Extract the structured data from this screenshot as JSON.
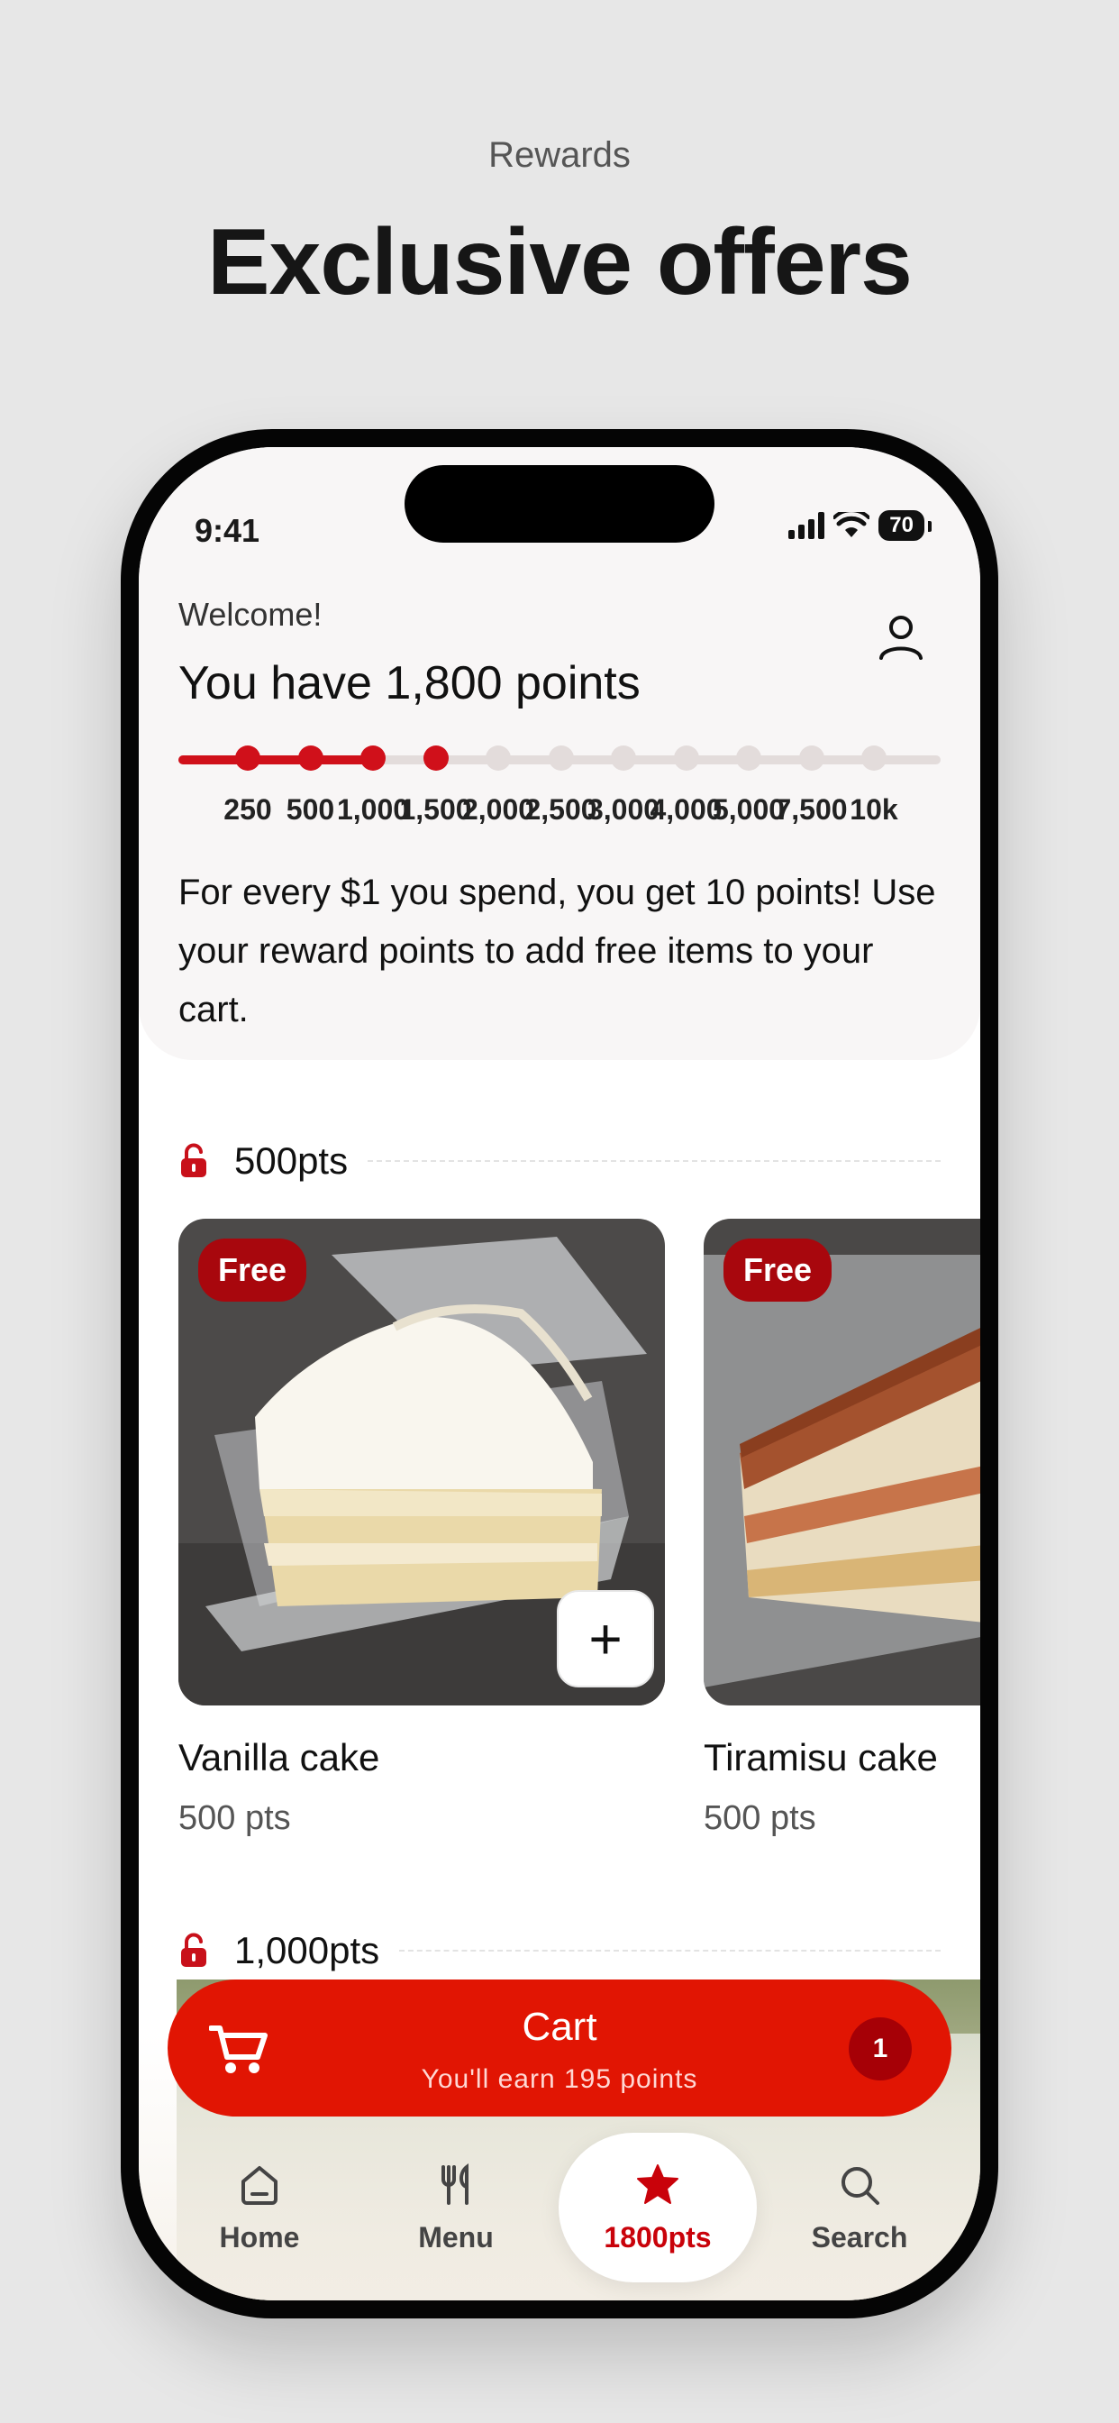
{
  "promo": {
    "eyebrow": "Rewards",
    "title": "Exclusive offers"
  },
  "status_bar": {
    "time": "9:41",
    "battery": "70"
  },
  "header": {
    "welcome": "Welcome!",
    "points_title": "You have 1,800 points",
    "profile_icon": "user-icon"
  },
  "progress": {
    "current_points": 1800,
    "tiers": [
      "250",
      "500",
      "1,000",
      "1,500",
      "2,000",
      "2,500",
      "3,000",
      "4,000",
      "5,000",
      "7,500",
      "10k"
    ],
    "reached_tiers": 4,
    "accent": "#d0101a",
    "track": "#e3dcdb"
  },
  "info": {
    "text": "For every $1 you spend, you get 10 points! Use your reward points to add free items to your cart."
  },
  "sections": [
    {
      "label": "500pts",
      "icon": "unlock-icon",
      "items": [
        {
          "badge": "Free",
          "name": "Vanilla cake",
          "pts": "500 pts",
          "add_icon": "plus-icon"
        },
        {
          "badge": "Free",
          "name": "Tiramisu cake",
          "pts": "500 pts"
        }
      ]
    },
    {
      "label": "1,000pts",
      "icon": "unlock-icon"
    }
  ],
  "cart": {
    "title": "Cart",
    "subtitle": "You'll earn 195 points",
    "count": "1",
    "icon": "cart-icon",
    "color": "#e11503"
  },
  "tabbar": {
    "tabs": [
      {
        "label": "Home",
        "icon": "home-icon"
      },
      {
        "label": "Menu",
        "icon": "utensils-icon"
      },
      {
        "label": "1800pts",
        "icon": "star-icon",
        "active": true
      },
      {
        "label": "Search",
        "icon": "search-icon"
      }
    ]
  }
}
